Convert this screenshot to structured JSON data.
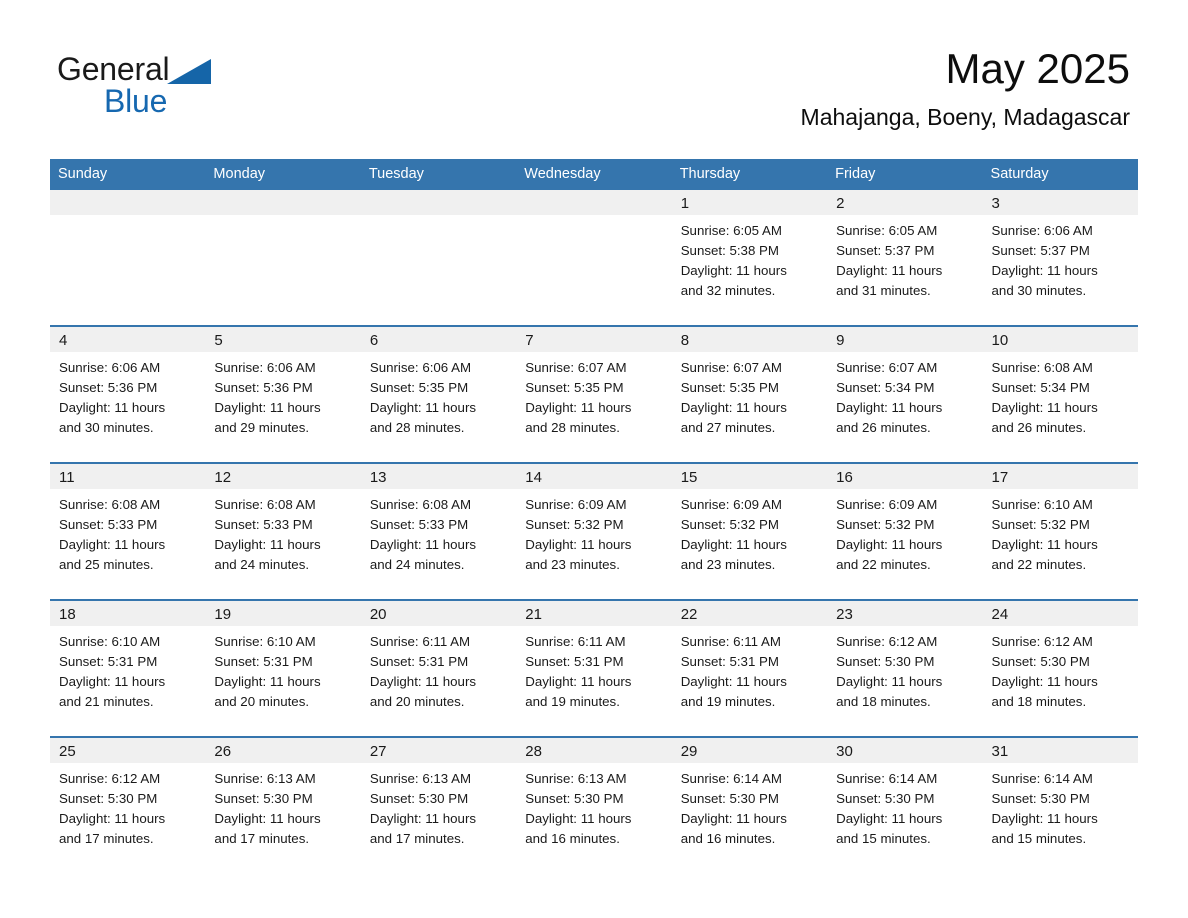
{
  "brand": {
    "name_part1": "General",
    "name_part2": "Blue",
    "accent_color": "#1668b0",
    "triangle_icon": "triangle-icon"
  },
  "header": {
    "month_title": "May 2025",
    "location": "Mahajanga, Boeny, Madagascar"
  },
  "theme": {
    "header_blue": "#3575ad",
    "rule_blue": "#3575ad",
    "daynum_band": "#f0f0f0"
  },
  "weekday_headers": [
    "Sunday",
    "Monday",
    "Tuesday",
    "Wednesday",
    "Thursday",
    "Friday",
    "Saturday"
  ],
  "weeks": [
    [
      {
        "day": "",
        "sunrise": "",
        "sunset": "",
        "daylight1": "",
        "daylight2": ""
      },
      {
        "day": "",
        "sunrise": "",
        "sunset": "",
        "daylight1": "",
        "daylight2": ""
      },
      {
        "day": "",
        "sunrise": "",
        "sunset": "",
        "daylight1": "",
        "daylight2": ""
      },
      {
        "day": "",
        "sunrise": "",
        "sunset": "",
        "daylight1": "",
        "daylight2": ""
      },
      {
        "day": "1",
        "sunrise": "Sunrise: 6:05 AM",
        "sunset": "Sunset: 5:38 PM",
        "daylight1": "Daylight: 11 hours",
        "daylight2": "and 32 minutes."
      },
      {
        "day": "2",
        "sunrise": "Sunrise: 6:05 AM",
        "sunset": "Sunset: 5:37 PM",
        "daylight1": "Daylight: 11 hours",
        "daylight2": "and 31 minutes."
      },
      {
        "day": "3",
        "sunrise": "Sunrise: 6:06 AM",
        "sunset": "Sunset: 5:37 PM",
        "daylight1": "Daylight: 11 hours",
        "daylight2": "and 30 minutes."
      }
    ],
    [
      {
        "day": "4",
        "sunrise": "Sunrise: 6:06 AM",
        "sunset": "Sunset: 5:36 PM",
        "daylight1": "Daylight: 11 hours",
        "daylight2": "and 30 minutes."
      },
      {
        "day": "5",
        "sunrise": "Sunrise: 6:06 AM",
        "sunset": "Sunset: 5:36 PM",
        "daylight1": "Daylight: 11 hours",
        "daylight2": "and 29 minutes."
      },
      {
        "day": "6",
        "sunrise": "Sunrise: 6:06 AM",
        "sunset": "Sunset: 5:35 PM",
        "daylight1": "Daylight: 11 hours",
        "daylight2": "and 28 minutes."
      },
      {
        "day": "7",
        "sunrise": "Sunrise: 6:07 AM",
        "sunset": "Sunset: 5:35 PM",
        "daylight1": "Daylight: 11 hours",
        "daylight2": "and 28 minutes."
      },
      {
        "day": "8",
        "sunrise": "Sunrise: 6:07 AM",
        "sunset": "Sunset: 5:35 PM",
        "daylight1": "Daylight: 11 hours",
        "daylight2": "and 27 minutes."
      },
      {
        "day": "9",
        "sunrise": "Sunrise: 6:07 AM",
        "sunset": "Sunset: 5:34 PM",
        "daylight1": "Daylight: 11 hours",
        "daylight2": "and 26 minutes."
      },
      {
        "day": "10",
        "sunrise": "Sunrise: 6:08 AM",
        "sunset": "Sunset: 5:34 PM",
        "daylight1": "Daylight: 11 hours",
        "daylight2": "and 26 minutes."
      }
    ],
    [
      {
        "day": "11",
        "sunrise": "Sunrise: 6:08 AM",
        "sunset": "Sunset: 5:33 PM",
        "daylight1": "Daylight: 11 hours",
        "daylight2": "and 25 minutes."
      },
      {
        "day": "12",
        "sunrise": "Sunrise: 6:08 AM",
        "sunset": "Sunset: 5:33 PM",
        "daylight1": "Daylight: 11 hours",
        "daylight2": "and 24 minutes."
      },
      {
        "day": "13",
        "sunrise": "Sunrise: 6:08 AM",
        "sunset": "Sunset: 5:33 PM",
        "daylight1": "Daylight: 11 hours",
        "daylight2": "and 24 minutes."
      },
      {
        "day": "14",
        "sunrise": "Sunrise: 6:09 AM",
        "sunset": "Sunset: 5:32 PM",
        "daylight1": "Daylight: 11 hours",
        "daylight2": "and 23 minutes."
      },
      {
        "day": "15",
        "sunrise": "Sunrise: 6:09 AM",
        "sunset": "Sunset: 5:32 PM",
        "daylight1": "Daylight: 11 hours",
        "daylight2": "and 23 minutes."
      },
      {
        "day": "16",
        "sunrise": "Sunrise: 6:09 AM",
        "sunset": "Sunset: 5:32 PM",
        "daylight1": "Daylight: 11 hours",
        "daylight2": "and 22 minutes."
      },
      {
        "day": "17",
        "sunrise": "Sunrise: 6:10 AM",
        "sunset": "Sunset: 5:32 PM",
        "daylight1": "Daylight: 11 hours",
        "daylight2": "and 22 minutes."
      }
    ],
    [
      {
        "day": "18",
        "sunrise": "Sunrise: 6:10 AM",
        "sunset": "Sunset: 5:31 PM",
        "daylight1": "Daylight: 11 hours",
        "daylight2": "and 21 minutes."
      },
      {
        "day": "19",
        "sunrise": "Sunrise: 6:10 AM",
        "sunset": "Sunset: 5:31 PM",
        "daylight1": "Daylight: 11 hours",
        "daylight2": "and 20 minutes."
      },
      {
        "day": "20",
        "sunrise": "Sunrise: 6:11 AM",
        "sunset": "Sunset: 5:31 PM",
        "daylight1": "Daylight: 11 hours",
        "daylight2": "and 20 minutes."
      },
      {
        "day": "21",
        "sunrise": "Sunrise: 6:11 AM",
        "sunset": "Sunset: 5:31 PM",
        "daylight1": "Daylight: 11 hours",
        "daylight2": "and 19 minutes."
      },
      {
        "day": "22",
        "sunrise": "Sunrise: 6:11 AM",
        "sunset": "Sunset: 5:31 PM",
        "daylight1": "Daylight: 11 hours",
        "daylight2": "and 19 minutes."
      },
      {
        "day": "23",
        "sunrise": "Sunrise: 6:12 AM",
        "sunset": "Sunset: 5:30 PM",
        "daylight1": "Daylight: 11 hours",
        "daylight2": "and 18 minutes."
      },
      {
        "day": "24",
        "sunrise": "Sunrise: 6:12 AM",
        "sunset": "Sunset: 5:30 PM",
        "daylight1": "Daylight: 11 hours",
        "daylight2": "and 18 minutes."
      }
    ],
    [
      {
        "day": "25",
        "sunrise": "Sunrise: 6:12 AM",
        "sunset": "Sunset: 5:30 PM",
        "daylight1": "Daylight: 11 hours",
        "daylight2": "and 17 minutes."
      },
      {
        "day": "26",
        "sunrise": "Sunrise: 6:13 AM",
        "sunset": "Sunset: 5:30 PM",
        "daylight1": "Daylight: 11 hours",
        "daylight2": "and 17 minutes."
      },
      {
        "day": "27",
        "sunrise": "Sunrise: 6:13 AM",
        "sunset": "Sunset: 5:30 PM",
        "daylight1": "Daylight: 11 hours",
        "daylight2": "and 17 minutes."
      },
      {
        "day": "28",
        "sunrise": "Sunrise: 6:13 AM",
        "sunset": "Sunset: 5:30 PM",
        "daylight1": "Daylight: 11 hours",
        "daylight2": "and 16 minutes."
      },
      {
        "day": "29",
        "sunrise": "Sunrise: 6:14 AM",
        "sunset": "Sunset: 5:30 PM",
        "daylight1": "Daylight: 11 hours",
        "daylight2": "and 16 minutes."
      },
      {
        "day": "30",
        "sunrise": "Sunrise: 6:14 AM",
        "sunset": "Sunset: 5:30 PM",
        "daylight1": "Daylight: 11 hours",
        "daylight2": "and 15 minutes."
      },
      {
        "day": "31",
        "sunrise": "Sunrise: 6:14 AM",
        "sunset": "Sunset: 5:30 PM",
        "daylight1": "Daylight: 11 hours",
        "daylight2": "and 15 minutes."
      }
    ]
  ]
}
